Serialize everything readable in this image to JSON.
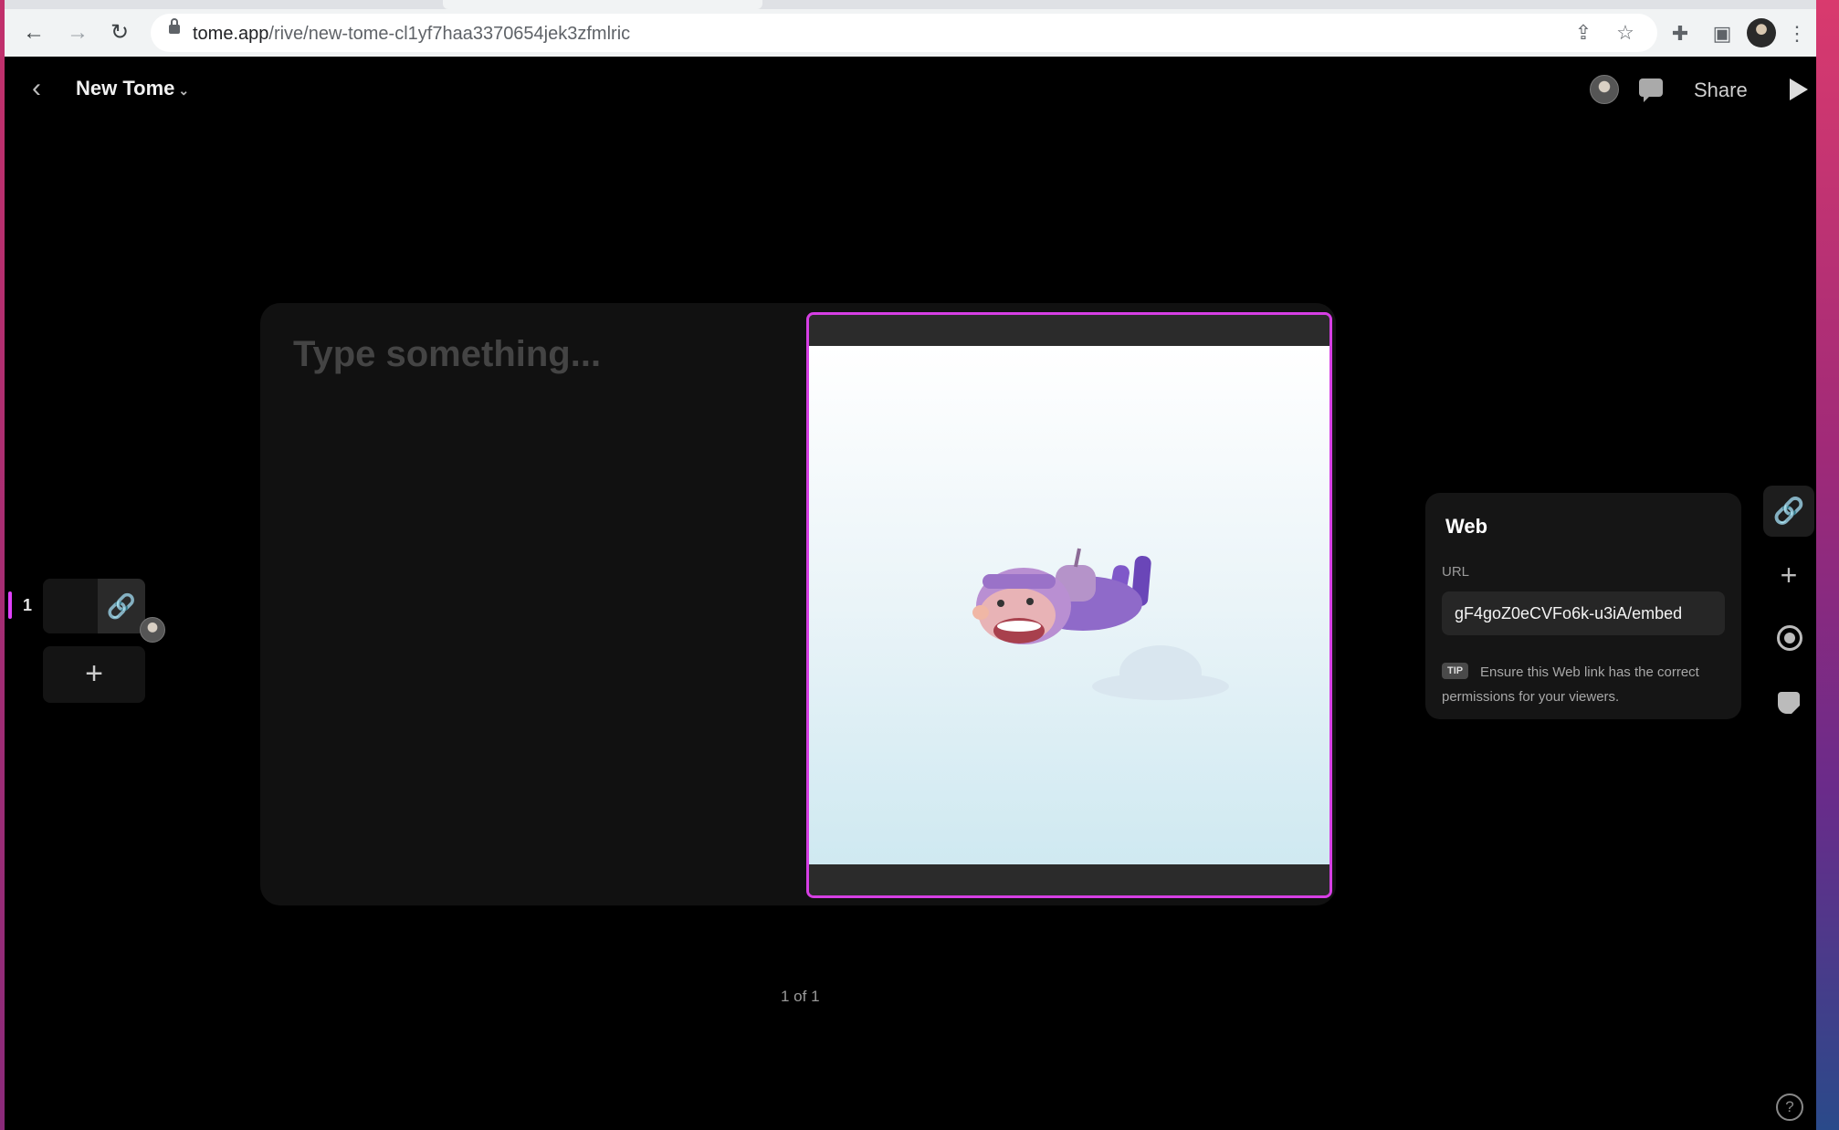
{
  "browser": {
    "url_host": "tome.app",
    "url_path": "/rive/new-tome-cl1yf7haa3370654jek3zfmlric",
    "icons": [
      "back-icon",
      "forward-icon",
      "reload-icon",
      "lock-icon",
      "share-icon",
      "star-icon",
      "extensions-icon",
      "side-panel-icon",
      "profile-avatar",
      "menu-icon"
    ]
  },
  "header": {
    "back_glyph": "‹",
    "title": "New Tome",
    "caret": "⌄",
    "share_label": "Share"
  },
  "slides": {
    "current_number": "1",
    "link_glyph": "🔗",
    "add_glyph": "+"
  },
  "page": {
    "placeholder": "Type something...",
    "counter": "1 of 1"
  },
  "web_panel": {
    "title": "Web",
    "url_label": "URL",
    "url_value": "gF4goZ0eCVFo6k-u3iA/embed",
    "tip_badge": "TIP",
    "tip_text": "Ensure this Web link has the correct permissions for your viewers."
  },
  "rail": {
    "link_glyph": "🔗",
    "add_glyph": "+"
  },
  "help_glyph": "?",
  "colors": {
    "accent": "#d63fe4",
    "background": "#000000",
    "panel": "#151515"
  }
}
